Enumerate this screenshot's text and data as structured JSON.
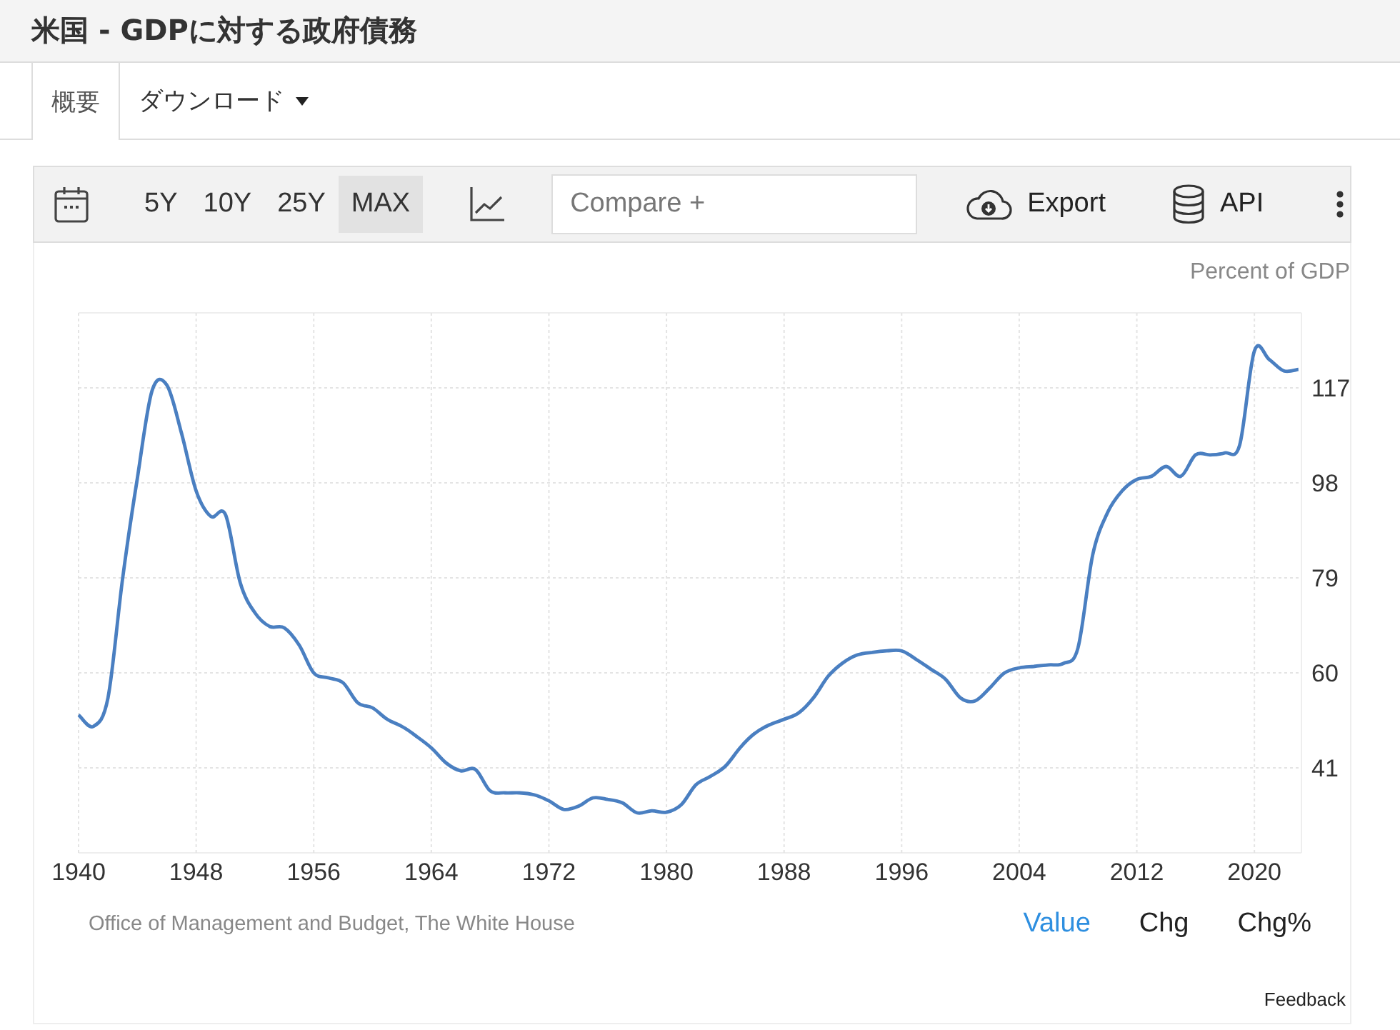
{
  "page": {
    "title": "米国 - GDPに対する政府債務"
  },
  "tabs": [
    {
      "label": "概要",
      "selected": true
    },
    {
      "label": "ダウンロード",
      "selected": false,
      "dropdown": true
    }
  ],
  "toolbar": {
    "ranges": [
      {
        "label": "5Y",
        "selected": false
      },
      {
        "label": "10Y",
        "selected": false
      },
      {
        "label": "25Y",
        "selected": false
      },
      {
        "label": "MAX",
        "selected": true
      }
    ],
    "compare": {
      "placeholder": "Compare +"
    },
    "export": "Export",
    "api": "API"
  },
  "chart": {
    "chart_data": {
      "type": "line",
      "ylabel": "Percent of GDP",
      "x": [
        1940,
        1941,
        1942,
        1943,
        1944,
        1945,
        1946,
        1947,
        1948,
        1949,
        1950,
        1951,
        1952,
        1953,
        1954,
        1955,
        1956,
        1957,
        1958,
        1959,
        1960,
        1961,
        1962,
        1963,
        1964,
        1965,
        1966,
        1967,
        1968,
        1969,
        1970,
        1971,
        1972,
        1973,
        1974,
        1975,
        1976,
        1977,
        1978,
        1979,
        1980,
        1981,
        1982,
        1983,
        1984,
        1985,
        1986,
        1987,
        1988,
        1989,
        1990,
        1991,
        1992,
        1993,
        1994,
        1995,
        1996,
        1997,
        1998,
        1999,
        2000,
        2001,
        2002,
        2003,
        2004,
        2005,
        2006,
        2007,
        2008,
        2009,
        2010,
        2011,
        2012,
        2013,
        2014,
        2015,
        2016,
        2017,
        2018,
        2019,
        2020,
        2021,
        2022,
        2023
      ],
      "series": [
        {
          "color": "#4a7fc1",
          "values": [
            51.6,
            49.3,
            55,
            79,
            99,
            116.4,
            117.6,
            108,
            96.4,
            91.3,
            91.6,
            78,
            72,
            69.3,
            69,
            65.6,
            60,
            59,
            58,
            54,
            53,
            50.7,
            49.3,
            47.3,
            45,
            42,
            40.4,
            40.7,
            36.4,
            36,
            36,
            35.6,
            34.4,
            32.7,
            33.3,
            35,
            34.7,
            34,
            32,
            32.4,
            32.1,
            33.6,
            37.6,
            39.3,
            41.3,
            45,
            47.9,
            49.6,
            50.7,
            52,
            55,
            59.3,
            62,
            63.6,
            64.1,
            64.4,
            64.4,
            62.7,
            60.7,
            58.7,
            55,
            54.4,
            57,
            60,
            61,
            61.3,
            61.6,
            61.9,
            65,
            83.6,
            92,
            96.4,
            98.7,
            99.3,
            101.3,
            99.3,
            103.6,
            103.6,
            104,
            105.6,
            124.4,
            122.7,
            120.4,
            120.7
          ]
        }
      ],
      "xlim": [
        1940,
        2023.2
      ],
      "ylim": [
        24,
        132
      ],
      "xticks": [
        1940,
        1948,
        1956,
        1964,
        1972,
        1980,
        1988,
        1996,
        2004,
        2012,
        2020
      ],
      "yticks": [
        41,
        60,
        79,
        98,
        117
      ],
      "grid": true
    },
    "source": "Office of Management and Budget, The White House",
    "views": [
      {
        "label": "Value",
        "selected": true
      },
      {
        "label": "Chg",
        "selected": false
      },
      {
        "label": "Chg%",
        "selected": false
      }
    ],
    "feedback": "Feedback"
  }
}
